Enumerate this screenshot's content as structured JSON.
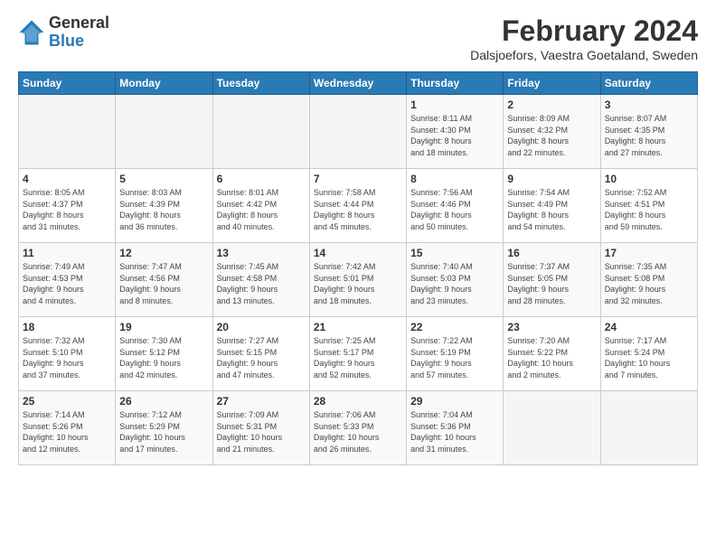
{
  "logo": {
    "general": "General",
    "blue": "Blue"
  },
  "header": {
    "month_year": "February 2024",
    "location": "Dalsjoefors, Vaestra Goetaland, Sweden"
  },
  "days_of_week": [
    "Sunday",
    "Monday",
    "Tuesday",
    "Wednesday",
    "Thursday",
    "Friday",
    "Saturday"
  ],
  "weeks": [
    [
      {
        "day": "",
        "info": ""
      },
      {
        "day": "",
        "info": ""
      },
      {
        "day": "",
        "info": ""
      },
      {
        "day": "",
        "info": ""
      },
      {
        "day": "1",
        "info": "Sunrise: 8:11 AM\nSunset: 4:30 PM\nDaylight: 8 hours\nand 18 minutes."
      },
      {
        "day": "2",
        "info": "Sunrise: 8:09 AM\nSunset: 4:32 PM\nDaylight: 8 hours\nand 22 minutes."
      },
      {
        "day": "3",
        "info": "Sunrise: 8:07 AM\nSunset: 4:35 PM\nDaylight: 8 hours\nand 27 minutes."
      }
    ],
    [
      {
        "day": "4",
        "info": "Sunrise: 8:05 AM\nSunset: 4:37 PM\nDaylight: 8 hours\nand 31 minutes."
      },
      {
        "day": "5",
        "info": "Sunrise: 8:03 AM\nSunset: 4:39 PM\nDaylight: 8 hours\nand 36 minutes."
      },
      {
        "day": "6",
        "info": "Sunrise: 8:01 AM\nSunset: 4:42 PM\nDaylight: 8 hours\nand 40 minutes."
      },
      {
        "day": "7",
        "info": "Sunrise: 7:58 AM\nSunset: 4:44 PM\nDaylight: 8 hours\nand 45 minutes."
      },
      {
        "day": "8",
        "info": "Sunrise: 7:56 AM\nSunset: 4:46 PM\nDaylight: 8 hours\nand 50 minutes."
      },
      {
        "day": "9",
        "info": "Sunrise: 7:54 AM\nSunset: 4:49 PM\nDaylight: 8 hours\nand 54 minutes."
      },
      {
        "day": "10",
        "info": "Sunrise: 7:52 AM\nSunset: 4:51 PM\nDaylight: 8 hours\nand 59 minutes."
      }
    ],
    [
      {
        "day": "11",
        "info": "Sunrise: 7:49 AM\nSunset: 4:53 PM\nDaylight: 9 hours\nand 4 minutes."
      },
      {
        "day": "12",
        "info": "Sunrise: 7:47 AM\nSunset: 4:56 PM\nDaylight: 9 hours\nand 8 minutes."
      },
      {
        "day": "13",
        "info": "Sunrise: 7:45 AM\nSunset: 4:58 PM\nDaylight: 9 hours\nand 13 minutes."
      },
      {
        "day": "14",
        "info": "Sunrise: 7:42 AM\nSunset: 5:01 PM\nDaylight: 9 hours\nand 18 minutes."
      },
      {
        "day": "15",
        "info": "Sunrise: 7:40 AM\nSunset: 5:03 PM\nDaylight: 9 hours\nand 23 minutes."
      },
      {
        "day": "16",
        "info": "Sunrise: 7:37 AM\nSunset: 5:05 PM\nDaylight: 9 hours\nand 28 minutes."
      },
      {
        "day": "17",
        "info": "Sunrise: 7:35 AM\nSunset: 5:08 PM\nDaylight: 9 hours\nand 32 minutes."
      }
    ],
    [
      {
        "day": "18",
        "info": "Sunrise: 7:32 AM\nSunset: 5:10 PM\nDaylight: 9 hours\nand 37 minutes."
      },
      {
        "day": "19",
        "info": "Sunrise: 7:30 AM\nSunset: 5:12 PM\nDaylight: 9 hours\nand 42 minutes."
      },
      {
        "day": "20",
        "info": "Sunrise: 7:27 AM\nSunset: 5:15 PM\nDaylight: 9 hours\nand 47 minutes."
      },
      {
        "day": "21",
        "info": "Sunrise: 7:25 AM\nSunset: 5:17 PM\nDaylight: 9 hours\nand 52 minutes."
      },
      {
        "day": "22",
        "info": "Sunrise: 7:22 AM\nSunset: 5:19 PM\nDaylight: 9 hours\nand 57 minutes."
      },
      {
        "day": "23",
        "info": "Sunrise: 7:20 AM\nSunset: 5:22 PM\nDaylight: 10 hours\nand 2 minutes."
      },
      {
        "day": "24",
        "info": "Sunrise: 7:17 AM\nSunset: 5:24 PM\nDaylight: 10 hours\nand 7 minutes."
      }
    ],
    [
      {
        "day": "25",
        "info": "Sunrise: 7:14 AM\nSunset: 5:26 PM\nDaylight: 10 hours\nand 12 minutes."
      },
      {
        "day": "26",
        "info": "Sunrise: 7:12 AM\nSunset: 5:29 PM\nDaylight: 10 hours\nand 17 minutes."
      },
      {
        "day": "27",
        "info": "Sunrise: 7:09 AM\nSunset: 5:31 PM\nDaylight: 10 hours\nand 21 minutes."
      },
      {
        "day": "28",
        "info": "Sunrise: 7:06 AM\nSunset: 5:33 PM\nDaylight: 10 hours\nand 26 minutes."
      },
      {
        "day": "29",
        "info": "Sunrise: 7:04 AM\nSunset: 5:36 PM\nDaylight: 10 hours\nand 31 minutes."
      },
      {
        "day": "",
        "info": ""
      },
      {
        "day": "",
        "info": ""
      }
    ]
  ]
}
